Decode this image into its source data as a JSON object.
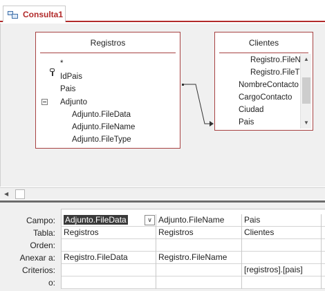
{
  "tab": {
    "title": "Consulta1"
  },
  "tables": [
    {
      "title": "Registros",
      "fields": [
        {
          "label": "*"
        },
        {
          "label": "IdPais"
        },
        {
          "label": "Pais"
        },
        {
          "label": "Adjunto"
        },
        {
          "label": "Adjunto.FileData"
        },
        {
          "label": "Adjunto.FileName"
        },
        {
          "label": "Adjunto.FileType"
        }
      ]
    },
    {
      "title": "Clientes",
      "fields": [
        {
          "label": "Registro.FileN"
        },
        {
          "label": "Registro.FileT"
        },
        {
          "label": "NombreContacto"
        },
        {
          "label": "CargoContacto"
        },
        {
          "label": "Ciudad"
        },
        {
          "label": "Pais"
        }
      ]
    }
  ],
  "grid": {
    "row_labels": [
      "Campo:",
      "Tabla:",
      "Orden:",
      "Anexar a:",
      "Criterios:",
      "o:"
    ],
    "columns": [
      {
        "campo": "Adjunto.FileData",
        "tabla": "Registros",
        "orden": "",
        "anexar": "Registro.FileData",
        "criterios": "",
        "o": ""
      },
      {
        "campo": "Adjunto.FileName",
        "tabla": "Registros",
        "orden": "",
        "anexar": "Registro.FileName",
        "criterios": "",
        "o": ""
      },
      {
        "campo": "Pais",
        "tabla": "Clientes",
        "orden": "",
        "anexar": "",
        "criterios": "[registros].[pais]",
        "o": ""
      }
    ]
  },
  "colors": {
    "accent": "#b22a2a",
    "table_border": "#a64141"
  }
}
